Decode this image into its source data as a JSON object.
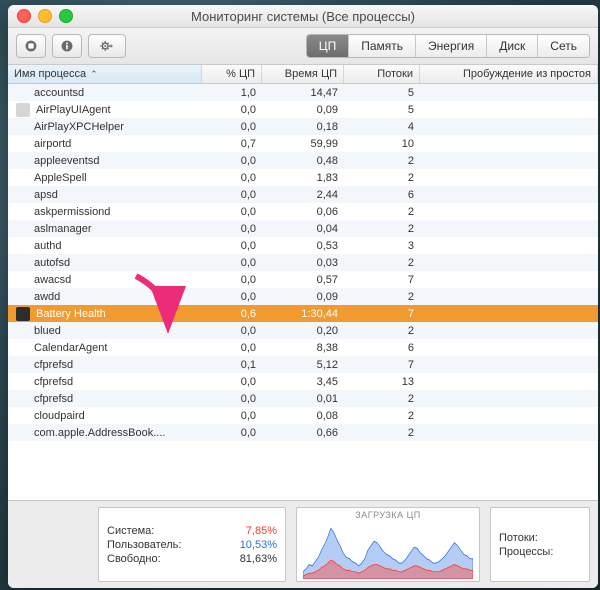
{
  "window": {
    "title": "Мониторинг системы (Все процессы)"
  },
  "tabs": [
    {
      "label": "ЦП",
      "selected": true
    },
    {
      "label": "Память"
    },
    {
      "label": "Энергия"
    },
    {
      "label": "Диск"
    },
    {
      "label": "Сеть"
    }
  ],
  "columns": {
    "name": "Имя процесса",
    "cpu": "% ЦП",
    "time": "Время ЦП",
    "threads": "Потоки",
    "wakeups": "Пробуждение из простоя"
  },
  "processes": [
    {
      "name": "accountsd",
      "cpu": "1,0",
      "time": "14,47",
      "threads": "5"
    },
    {
      "name": "AirPlayUIAgent",
      "cpu": "0,0",
      "time": "0,09",
      "threads": "5",
      "icon": "a"
    },
    {
      "name": "AirPlayXPCHelper",
      "cpu": "0,0",
      "time": "0,18",
      "threads": "4"
    },
    {
      "name": "airportd",
      "cpu": "0,7",
      "time": "59,99",
      "threads": "10"
    },
    {
      "name": "appleeventsd",
      "cpu": "0,0",
      "time": "0,48",
      "threads": "2"
    },
    {
      "name": "AppleSpell",
      "cpu": "0,0",
      "time": "1,83",
      "threads": "2"
    },
    {
      "name": "apsd",
      "cpu": "0,0",
      "time": "2,44",
      "threads": "6"
    },
    {
      "name": "askpermissiond",
      "cpu": "0,0",
      "time": "0,06",
      "threads": "2"
    },
    {
      "name": "aslmanager",
      "cpu": "0,0",
      "time": "0,04",
      "threads": "2"
    },
    {
      "name": "authd",
      "cpu": "0,0",
      "time": "0,53",
      "threads": "3"
    },
    {
      "name": "autofsd",
      "cpu": "0,0",
      "time": "0,03",
      "threads": "2"
    },
    {
      "name": "awacsd",
      "cpu": "0,0",
      "time": "0,57",
      "threads": "7"
    },
    {
      "name": "awdd",
      "cpu": "0,0",
      "time": "0,09",
      "threads": "2"
    },
    {
      "name": "Battery Health",
      "cpu": "0,6",
      "time": "1:30,44",
      "threads": "7",
      "icon": "b",
      "selected": true
    },
    {
      "name": "blued",
      "cpu": "0,0",
      "time": "0,20",
      "threads": "2"
    },
    {
      "name": "CalendarAgent",
      "cpu": "0,0",
      "time": "8,38",
      "threads": "6"
    },
    {
      "name": "cfprefsd",
      "cpu": "0,1",
      "time": "5,12",
      "threads": "7"
    },
    {
      "name": "cfprefsd",
      "cpu": "0,0",
      "time": "3,45",
      "threads": "13"
    },
    {
      "name": "cfprefsd",
      "cpu": "0,0",
      "time": "0,01",
      "threads": "2"
    },
    {
      "name": "cloudpaird",
      "cpu": "0,0",
      "time": "0,08",
      "threads": "2"
    },
    {
      "name": "com.apple.AddressBook....",
      "cpu": "0,0",
      "time": "0,66",
      "threads": "2"
    },
    {
      "name": " ",
      "cpu": " ",
      "time": " ",
      "threads": " "
    }
  ],
  "summary": {
    "system_label": "Система:",
    "system_value": "7,85%",
    "user_label": "Пользователь:",
    "user_value": "10,53%",
    "idle_label": "Свободно:",
    "idle_value": "81,63%"
  },
  "chart": {
    "title": "ЗАГРУЗКА ЦП"
  },
  "right_summary": {
    "threads_label": "Потоки:",
    "procs_label": "Процессы:"
  },
  "chart_data": {
    "type": "area",
    "title": "ЗАГРУЗКА ЦП",
    "xlabel": "",
    "ylabel": "%",
    "ylim": [
      0,
      100
    ],
    "series": [
      {
        "name": "Пользователь",
        "color": "#2b6fe0",
        "values": [
          3,
          4,
          6,
          5,
          7,
          9,
          12,
          15,
          18,
          22,
          20,
          17,
          14,
          11,
          9,
          8,
          7,
          6,
          5,
          6,
          8,
          12,
          14,
          16,
          15,
          13,
          11,
          10,
          9,
          8,
          7,
          6,
          6,
          7,
          9,
          11,
          13,
          12,
          10,
          9,
          8,
          7,
          6,
          6,
          7,
          8,
          9,
          11,
          13,
          15,
          14,
          12,
          10,
          9,
          8,
          8
        ]
      },
      {
        "name": "Система",
        "color": "#ff3b30",
        "values": [
          2,
          3,
          4,
          4,
          5,
          6,
          8,
          9,
          11,
          13,
          12,
          10,
          9,
          7,
          6,
          6,
          5,
          5,
          4,
          5,
          6,
          8,
          9,
          10,
          10,
          9,
          8,
          7,
          7,
          6,
          6,
          5,
          5,
          6,
          7,
          8,
          9,
          9,
          8,
          7,
          6,
          6,
          5,
          5,
          5,
          6,
          7,
          8,
          9,
          10,
          9,
          8,
          7,
          7,
          6,
          6
        ]
      }
    ]
  }
}
